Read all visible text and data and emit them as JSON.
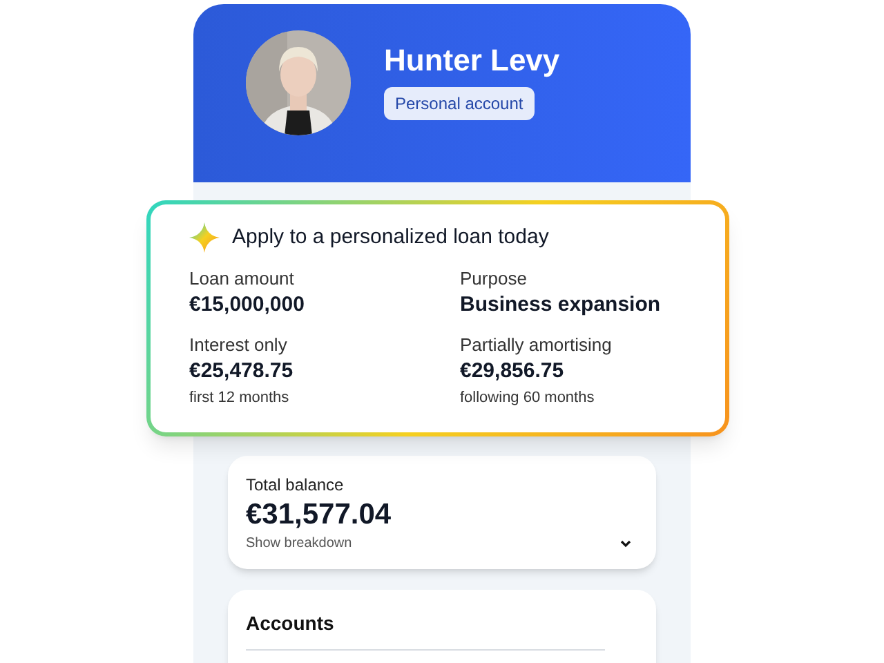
{
  "profile": {
    "name": "Hunter Levy",
    "badge": "Personal account"
  },
  "loan_offer": {
    "title": "Apply to a personalized loan today",
    "fields": [
      {
        "label": "Loan amount",
        "value": "€15,000,000"
      },
      {
        "label": "Purpose",
        "value": "Business expansion"
      },
      {
        "label": "Interest only",
        "value": "€25,478.75",
        "note": "first 12 months"
      },
      {
        "label": "Partially amortising",
        "value": "€29,856.75",
        "note": "following 60 months"
      }
    ]
  },
  "balance": {
    "label": "Total balance",
    "amount": "€31,577.04",
    "toggle": "Show breakdown",
    "expanded": false
  },
  "accounts": {
    "title": "Accounts"
  }
}
